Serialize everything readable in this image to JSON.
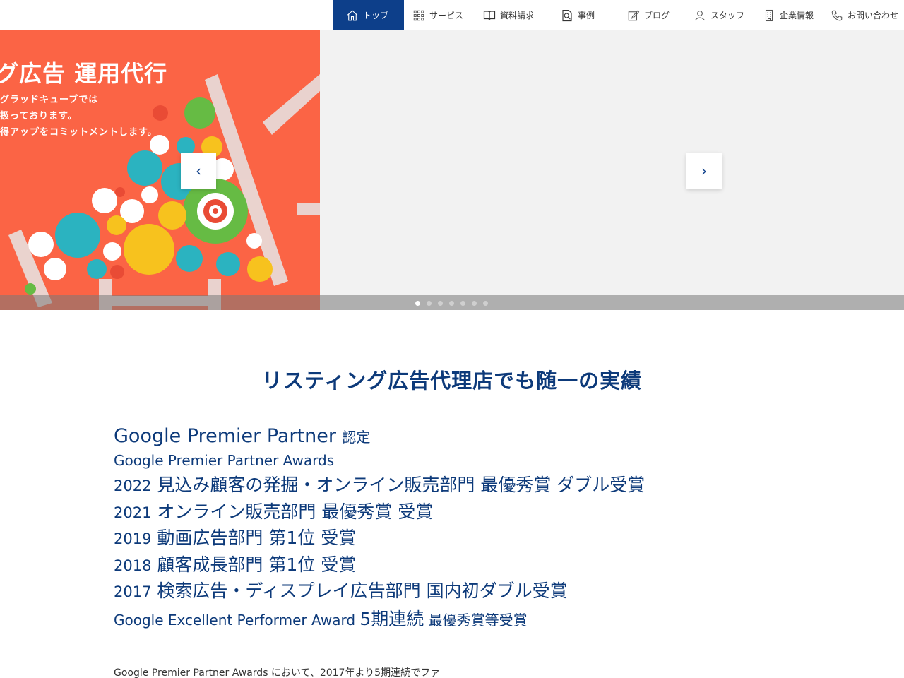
{
  "nav": {
    "items": [
      {
        "label": "トップ",
        "icon": "home-icon"
      },
      {
        "label": "サービス",
        "icon": "grid-icon"
      },
      {
        "label": "資料請求",
        "icon": "book-icon"
      },
      {
        "label": "事例",
        "icon": "magnifier-doc-icon"
      },
      {
        "label": "ブログ",
        "icon": "edit-icon"
      },
      {
        "label": "スタッフ",
        "icon": "person-icon"
      },
      {
        "label": "企業情報",
        "icon": "building-icon"
      },
      {
        "label": "お問い合わせ",
        "icon": "phone-icon"
      }
    ],
    "active_color": "#0d3f8a"
  },
  "hero": {
    "slide": {
      "title": "グ広告 運用代行",
      "lines": [
        "グラッドキューブでは",
        "扱っております。",
        "得アップをコミットメントします。"
      ],
      "bg_color": "#fb6445"
    },
    "prev_arrow": "‹",
    "next_arrow": "›",
    "dots": {
      "count": 7,
      "active": 0
    }
  },
  "achievements": {
    "title": "リスティング広告代理店でも随一の実績",
    "partner_main": "Google Premier Partner",
    "partner_suffix": "認定",
    "awards_heading": "Google Premier Partner Awards",
    "awards": [
      {
        "year": "2022",
        "text": "見込み顧客の発掘・オンライン販売部門 最優秀賞 ダブル受賞"
      },
      {
        "year": "2021",
        "text": "オンライン販売部門 最優秀賞 受賞"
      },
      {
        "year": "2019",
        "text": "動画広告部門 第1位 受賞"
      },
      {
        "year": "2018",
        "text": "顧客成長部門 第1位 受賞"
      },
      {
        "year": "2017",
        "text": "検索広告・ディスプレイ広告部門 国内初ダブル受賞"
      }
    ],
    "excellent_prefix": "Google Excellent Performer Award",
    "excellent_big": "5期連続",
    "excellent_suffix": "最優秀賞等受賞",
    "note": "Google Premier Partner Awards において、2017年より5期連続でファ"
  }
}
